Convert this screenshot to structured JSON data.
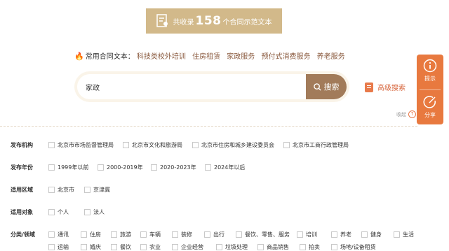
{
  "banner": {
    "prefix": "共收录",
    "count": "158",
    "suffix": "个合同示范文本"
  },
  "common": {
    "label": "常用合同文本：",
    "tags": [
      "科技类校外培训",
      "住房租赁",
      "家政服务",
      "预付式消费服务",
      "养老服务"
    ]
  },
  "search": {
    "value": "家政",
    "button": "搜索"
  },
  "advanced": "高级搜索",
  "collapse": "收起",
  "float": {
    "tip": "提示",
    "share": "分享"
  },
  "filters": {
    "publisher": {
      "label": "发布机构",
      "options": [
        "北京市市场监督管理局",
        "北京市文化和旅游局",
        "北京市住房和城乡建设委员会",
        "北京市工商行政管理局"
      ]
    },
    "year": {
      "label": "发布年份",
      "options": [
        "1999年以前",
        "2000-2019年",
        "2020-2023年",
        "2024年以后"
      ]
    },
    "region": {
      "label": "适用区域",
      "options": [
        "北京市",
        "京津冀"
      ]
    },
    "target": {
      "label": "适用对象",
      "options": [
        "个人",
        "法人"
      ]
    },
    "category": {
      "label": "分类/领域",
      "row1": [
        "通讯",
        "住房",
        "旅游",
        "车辆",
        "装修",
        "出行",
        "餐饮、零售、服务",
        "培训",
        "养老",
        "健身",
        "生活"
      ],
      "row2": [
        "运输",
        "婚庆",
        "餐饮",
        "农业",
        "企业经营",
        "垃圾处理",
        "商品销售",
        "拍卖",
        "场地/设备租赁"
      ]
    }
  }
}
